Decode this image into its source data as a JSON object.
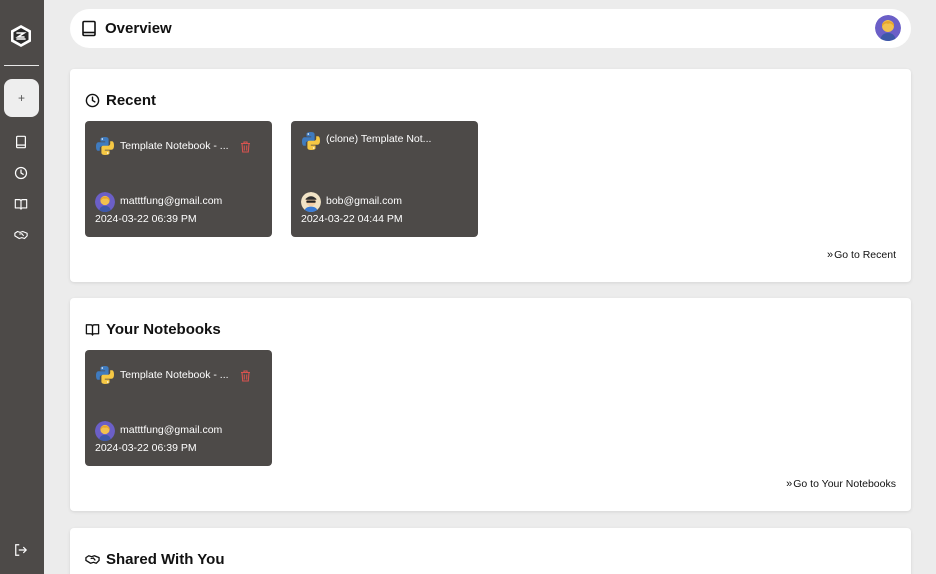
{
  "header": {
    "title": "Overview"
  },
  "sidebar": {
    "new_label": "+",
    "items": [
      {
        "name": "notebooks",
        "icon": "book-icon"
      },
      {
        "name": "recent",
        "icon": "clock-icon"
      },
      {
        "name": "your-notebooks",
        "icon": "open-book-icon"
      },
      {
        "name": "shared",
        "icon": "handshake-icon"
      }
    ],
    "logout_icon": "logout-icon"
  },
  "recent": {
    "title": "Recent",
    "cards": [
      {
        "title": "Template Notebook - ...",
        "email": "matttfung@gmail.com",
        "date": "2024-03-22 06:39 PM",
        "deletable": true
      },
      {
        "title": "(clone) Template Not...",
        "email": "bob@gmail.com",
        "date": "2024-03-22 04:44 PM",
        "deletable": false
      }
    ],
    "goto": "Go to Recent"
  },
  "your_notebooks": {
    "title": "Your Notebooks",
    "cards": [
      {
        "title": "Template Notebook - ...",
        "email": "matttfung@gmail.com",
        "date": "2024-03-22 06:39 PM",
        "deletable": true
      }
    ],
    "goto": "Go to Your Notebooks"
  },
  "shared": {
    "title": "Shared With You"
  },
  "colors": {
    "sidebar": "#4d4a48",
    "card": "#4d4a48",
    "background": "#ececec",
    "trash": "#d9534f"
  }
}
